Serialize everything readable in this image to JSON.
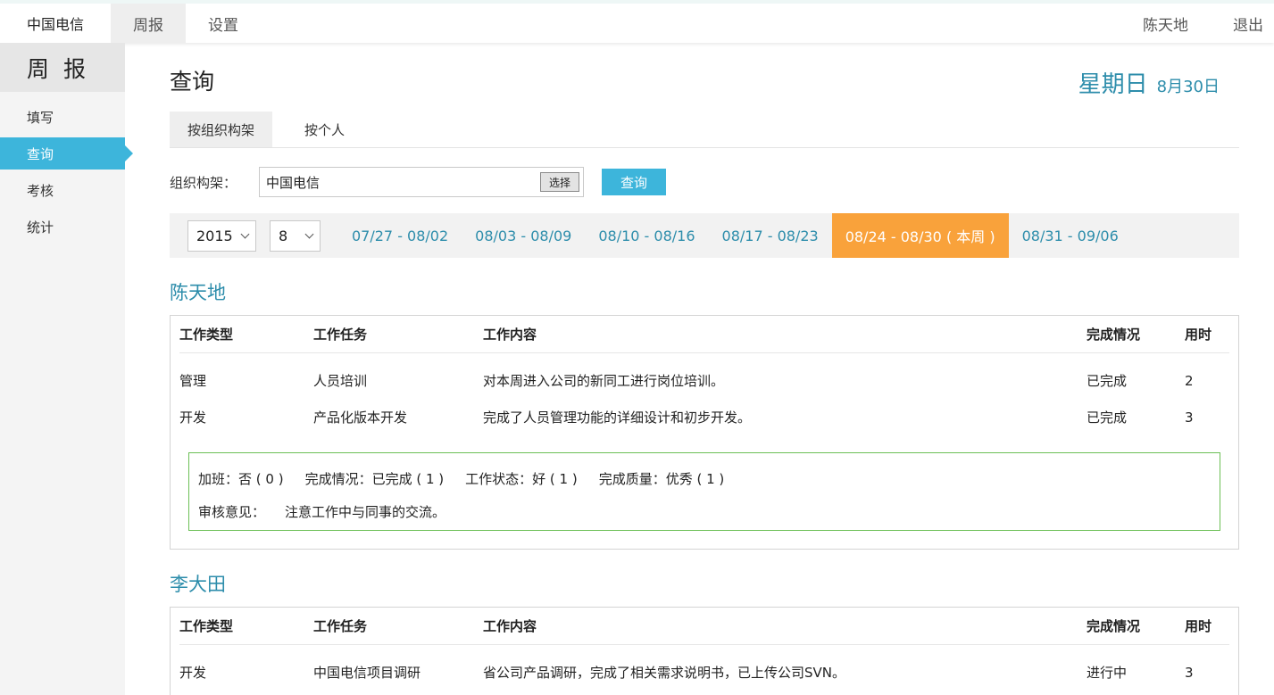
{
  "header": {
    "brand": "中国电信",
    "nav": [
      "周报",
      "设置"
    ],
    "user": "陈天地",
    "logout": "退出"
  },
  "sidebar": {
    "title": "周 报",
    "items": [
      {
        "label": "填写"
      },
      {
        "label": "查询"
      },
      {
        "label": "考核"
      },
      {
        "label": "统计"
      }
    ]
  },
  "main": {
    "title": "查询",
    "weekday": "星期日",
    "date": "8月30日",
    "tabs": [
      "按组织构架",
      "按个人"
    ],
    "org_label": "组织构架：",
    "org_value": "中国电信",
    "pick_label": "选择",
    "query_label": "查询",
    "year": "2015",
    "month": "8",
    "weeks": [
      "07/27 - 08/02",
      "08/03 - 08/09",
      "08/10 - 08/16",
      "08/17 - 08/23",
      "08/24 - 08/30 ( 本周 )",
      "08/31 - 09/06"
    ]
  },
  "columns": [
    "工作类型",
    "工作任务",
    "工作内容",
    "完成情况",
    "用时"
  ],
  "reports": [
    {
      "name": "陈天地",
      "rows": [
        [
          "管理",
          "人员培训",
          "对本周进入公司的新同工进行岗位培训。",
          "已完成",
          "2"
        ],
        [
          "开发",
          "产品化版本开发",
          "完成了人员管理功能的详细设计和初步开发。",
          "已完成",
          "3"
        ]
      ],
      "summary": {
        "overtime": "加班：否 ( 0 )",
        "completion": "完成情况：已完成 ( 1 )",
        "status": "工作状态：好 ( 1 )",
        "quality": "完成质量：优秀 ( 1 )",
        "opinion_label": "审核意见：",
        "opinion": "注意工作中与同事的交流。"
      }
    },
    {
      "name": "李大田",
      "rows": [
        [
          "开发",
          "中国电信项目调研",
          "省公司产品调研，完成了相关需求说明书，已上传公司SVN。",
          "进行中",
          "3"
        ]
      ]
    }
  ],
  "colors": {
    "accent": "#3db5db",
    "link": "#2d8dab",
    "current_week": "#f9a23b",
    "summary_border": "#6cbf56"
  }
}
